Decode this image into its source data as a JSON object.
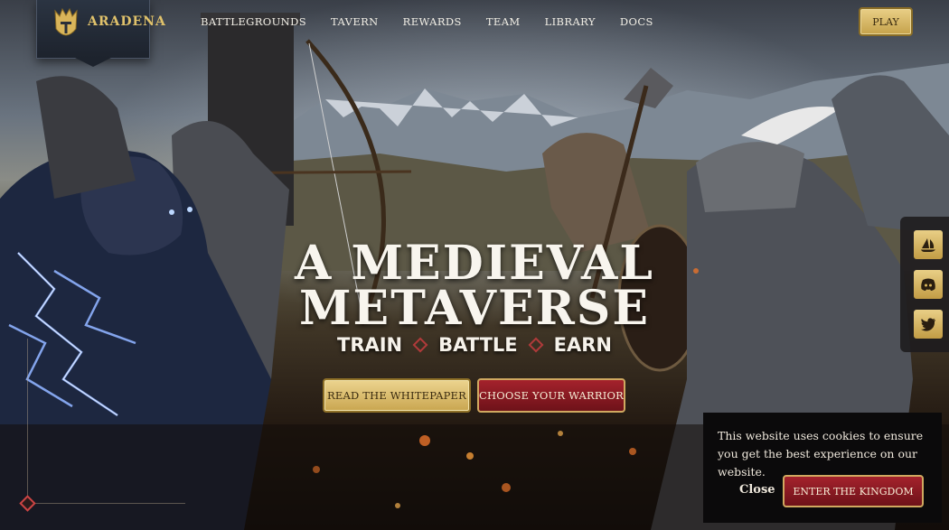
{
  "brand": {
    "name": "ARADENA"
  },
  "nav": {
    "items": [
      "BATTLEGROUNDS",
      "TAVERN",
      "REWARDS",
      "TEAM",
      "LIBRARY",
      "DOCS"
    ],
    "play_label": "PLAY"
  },
  "hero": {
    "title_line1": "A MEDIEVAL",
    "title_line2": "METAVERSE",
    "tagline": [
      "TRAIN",
      "BATTLE",
      "EARN"
    ],
    "whitepaper_label": "READ THE WHITEPAPER",
    "warrior_label": "CHOOSE YOUR WARRIOR"
  },
  "social": {
    "items": [
      "opensea-icon",
      "discord-icon",
      "twitter-icon"
    ]
  },
  "cookie": {
    "text": "This website uses cookies to ensure you get the best experience on our website.",
    "close_label": "Close",
    "enter_label": "ENTER THE KINGDOM"
  },
  "colors": {
    "gold": "#d9bb6a",
    "crimson": "#8e1a23",
    "dark_panel": "#0b0a0b"
  }
}
